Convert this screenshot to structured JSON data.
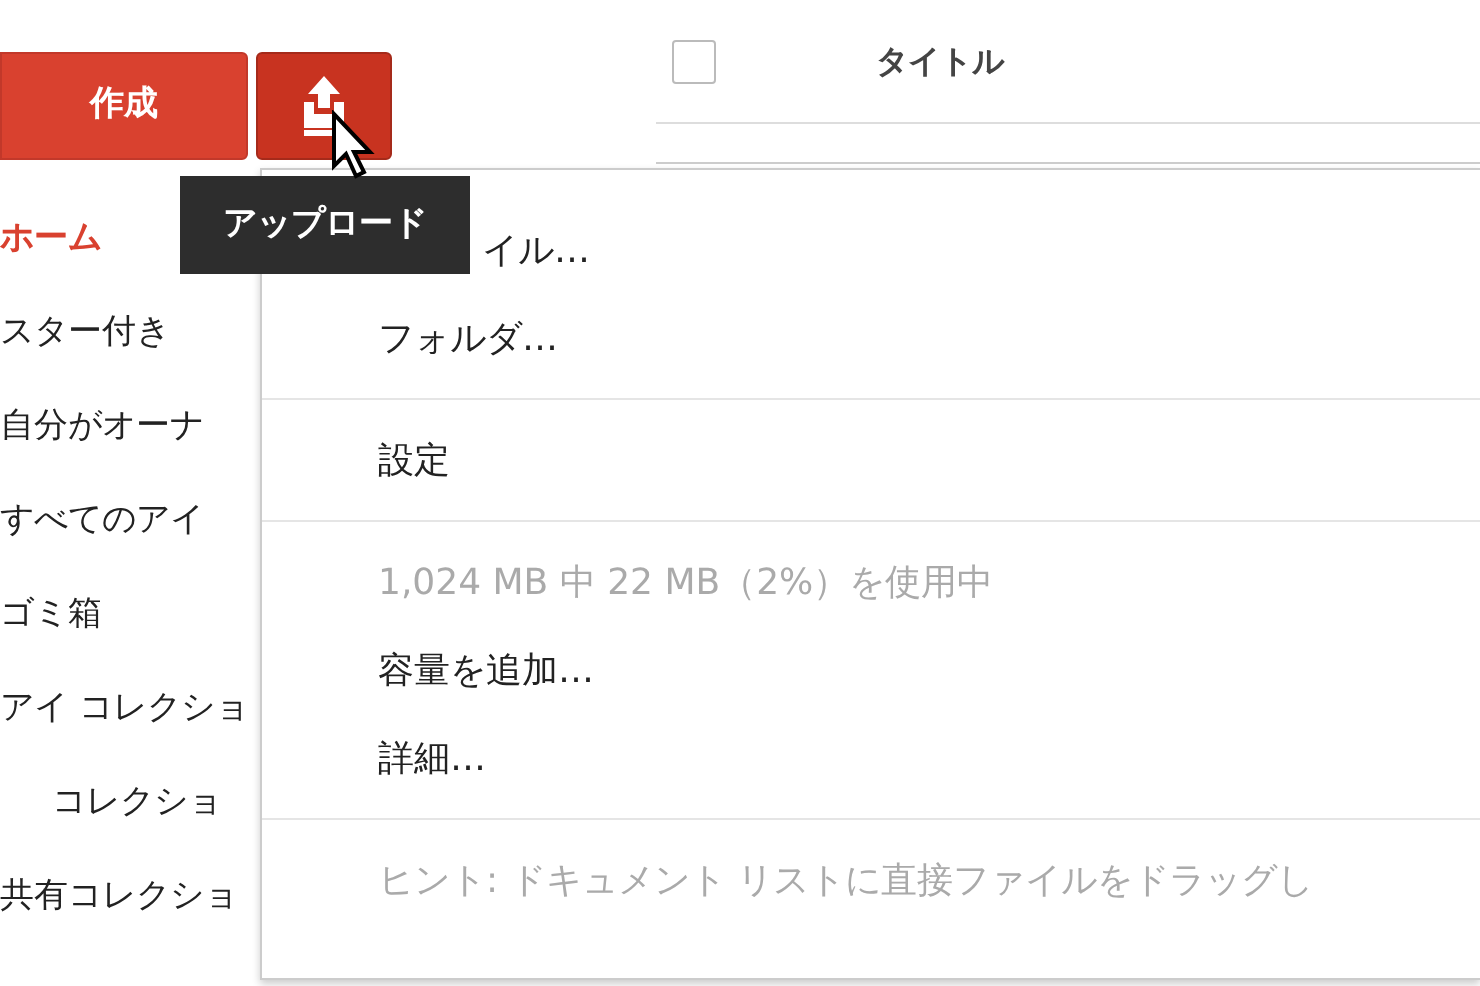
{
  "create_button": {
    "label": "作成"
  },
  "upload_button": {
    "tooltip": "アップロード"
  },
  "sidebar": {
    "items": [
      {
        "label": "ホーム",
        "selected": true
      },
      {
        "label": "スター付き",
        "selected": false
      },
      {
        "label": "自分がオーナ",
        "selected": false
      },
      {
        "label": "すべてのアイ",
        "selected": false
      },
      {
        "label": "ゴミ箱",
        "selected": false
      },
      {
        "label": "アイ コレクショ",
        "selected": false,
        "children": [
          {
            "label": "コレクショ",
            "selected": false
          }
        ]
      },
      {
        "label": "共有コレクショ",
        "selected": false
      }
    ]
  },
  "list_header": {
    "checkbox": {
      "checked": false
    },
    "column_title": "タイトル"
  },
  "upload_menu": {
    "sections": [
      [
        {
          "label": "イル…",
          "disabled": false
        },
        {
          "label": "フォルダ…",
          "disabled": false
        }
      ],
      [
        {
          "label": "設定",
          "disabled": false
        }
      ],
      [
        {
          "label": "1,024 MB 中 22 MB（2%）を使用中",
          "disabled": true
        },
        {
          "label": "容量を追加…",
          "disabled": false
        },
        {
          "label": "詳細…",
          "disabled": false
        }
      ],
      [
        {
          "label": "ヒント: ドキュメント リストに直接ファイルをドラッグし",
          "disabled": true
        }
      ]
    ]
  }
}
